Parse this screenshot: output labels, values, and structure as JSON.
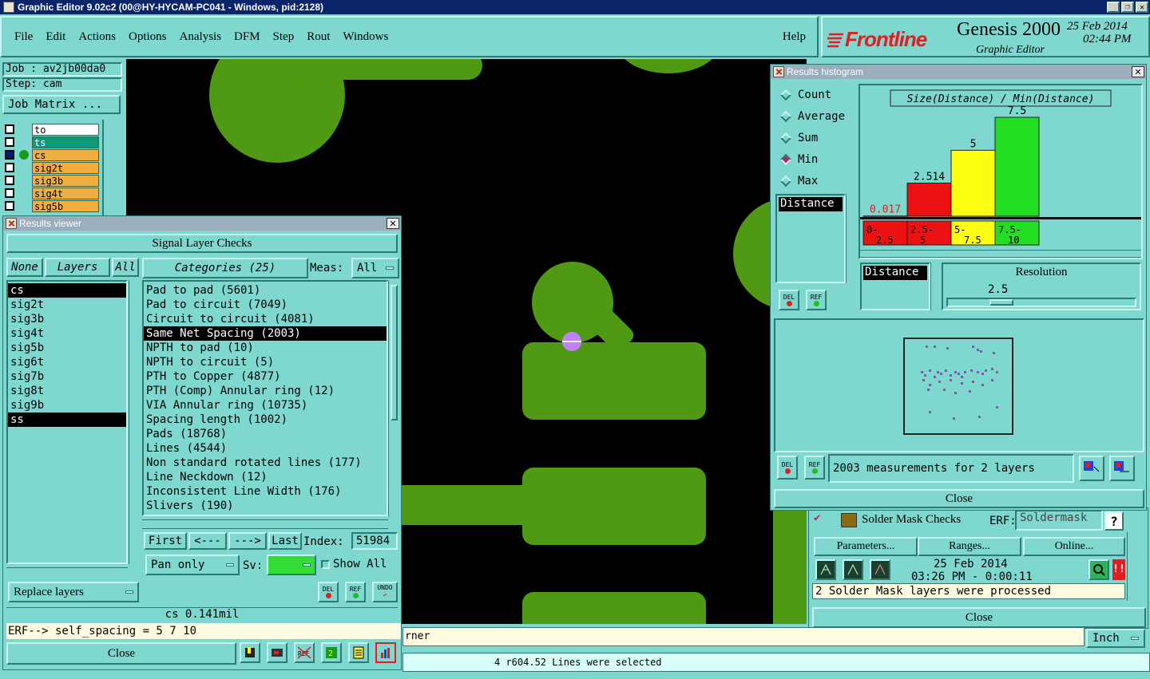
{
  "window_title": "Graphic Editor 9.02c2 (00@HY-HYCAM-PC041 - Windows, pid:2128)",
  "menu": [
    "File",
    "Edit",
    "Actions",
    "Options",
    "Analysis",
    "DFM",
    "Step",
    "Rout",
    "Windows"
  ],
  "help_label": "Help",
  "brand": {
    "logo": "Frontline",
    "product": "Genesis 2000",
    "date": "25 Feb 2014",
    "time": "02:44 PM",
    "subtitle": "Graphic Editor"
  },
  "job": {
    "job_label": "Job : av2jb00da0",
    "step_label": "Step: cam",
    "matrix_button": "Job Matrix ..."
  },
  "layers_panel": [
    {
      "name": "to",
      "color": "#ffffff"
    },
    {
      "name": "ts",
      "color": "#119977"
    },
    {
      "name": "cs",
      "color": "#f0b040"
    },
    {
      "name": "sig2t",
      "color": "#f0b040"
    },
    {
      "name": "sig3b",
      "color": "#f0b040"
    },
    {
      "name": "sig4t",
      "color": "#f0b040"
    },
    {
      "name": "sig5b",
      "color": "#f0b040"
    }
  ],
  "results_viewer": {
    "title": "Results viewer",
    "heading": "Signal Layer Checks",
    "none_btn": "None",
    "layers_btn": "Layers",
    "all_btn": "All",
    "categories_label": "Categories (25)",
    "meas_label": "Meas:",
    "meas_value": "All",
    "layer_list": [
      "cs",
      "sig2t",
      "sig3b",
      "sig4t",
      "sig5b",
      "sig6t",
      "sig7b",
      "sig8t",
      "sig9b",
      "ss"
    ],
    "selected_layers": [
      "cs",
      "ss"
    ],
    "categories": [
      "Pad to pad (5601)",
      "Pad to circuit (7049)",
      "Circuit to circuit (4081)",
      "Same Net Spacing (2003)",
      "NPTH to pad (10)",
      "NPTH to circuit (5)",
      "PTH to Copper (4877)",
      "PTH (Comp) Annular ring (12)",
      "VIA Annular ring (10735)",
      "Spacing length (1002)",
      "Pads (18768)",
      "Lines (4544)",
      "Non standard rotated lines (177)",
      "Line Neckdown (12)",
      "Inconsistent Line Width (176)",
      "Slivers (190)"
    ],
    "selected_category": "Same Net Spacing (2003)",
    "first_btn": "First",
    "prev_btn": "<---",
    "next_btn": "--->",
    "last_btn": "Last",
    "index_label": "Index:",
    "index_value": "51984",
    "replace_layers": "Replace layers",
    "pan_only": "Pan only",
    "sv_label": "Sv:",
    "show_all": "Show All",
    "del_label": "DEL",
    "ref_label": "REF",
    "undo_label": "UNDO",
    "status_value": "cs 0.141mil",
    "erf_line": "ERF--> self_spacing = 5 7 10",
    "close_label": "Close"
  },
  "histogram": {
    "title": "Results histogram",
    "radio_options": [
      "Count",
      "Average",
      "Sum",
      "Min",
      "Max"
    ],
    "selected_option": "Min",
    "left_list_item": "Distance",
    "chart_title": "Size(Distance) / Min(Distance)",
    "resolution_label": "Resolution",
    "resolution_value": "2.5",
    "distance_label": "Distance",
    "summary": "2003 measurements for 2 layers",
    "del_label": "DEL",
    "ref_label": "REF",
    "close_label": "Close"
  },
  "chart_data": {
    "type": "bar",
    "title": "Size(Distance) / Min(Distance)",
    "categories": [
      "0-2.5",
      "2.5-5",
      "5-7.5",
      "7.5-10"
    ],
    "values": [
      0.017,
      2.514,
      5,
      7.5
    ],
    "value_labels": [
      "0.017",
      "2.514",
      "5",
      "7.5"
    ],
    "colors": [
      "#ee1111",
      "#ee1111",
      "#ffff11",
      "#22dd22"
    ],
    "tick_labels": [
      [
        "0-",
        "2.5"
      ],
      [
        "2.5-",
        "5"
      ],
      [
        "5-",
        "7.5"
      ],
      [
        "7.5-",
        "10"
      ]
    ],
    "ylim": [
      0,
      7.5
    ]
  },
  "solder_panel": {
    "title": "Solder Mask Checks",
    "erf_label": "ERF:",
    "erf_value": "Soldermask",
    "help": "?",
    "parameters_btn": "Parameters...",
    "ranges_btn": "Ranges...",
    "online_btn": "Online...",
    "date": "25 Feb 2014",
    "time": "03:26 PM - 0:00:11",
    "message": "2 Solder Mask layers were processed",
    "close_label": "Close"
  },
  "bottom": {
    "message_fragment": "rner",
    "units": "Inch",
    "selection_status": "4 r604.52 Lines were selected"
  }
}
